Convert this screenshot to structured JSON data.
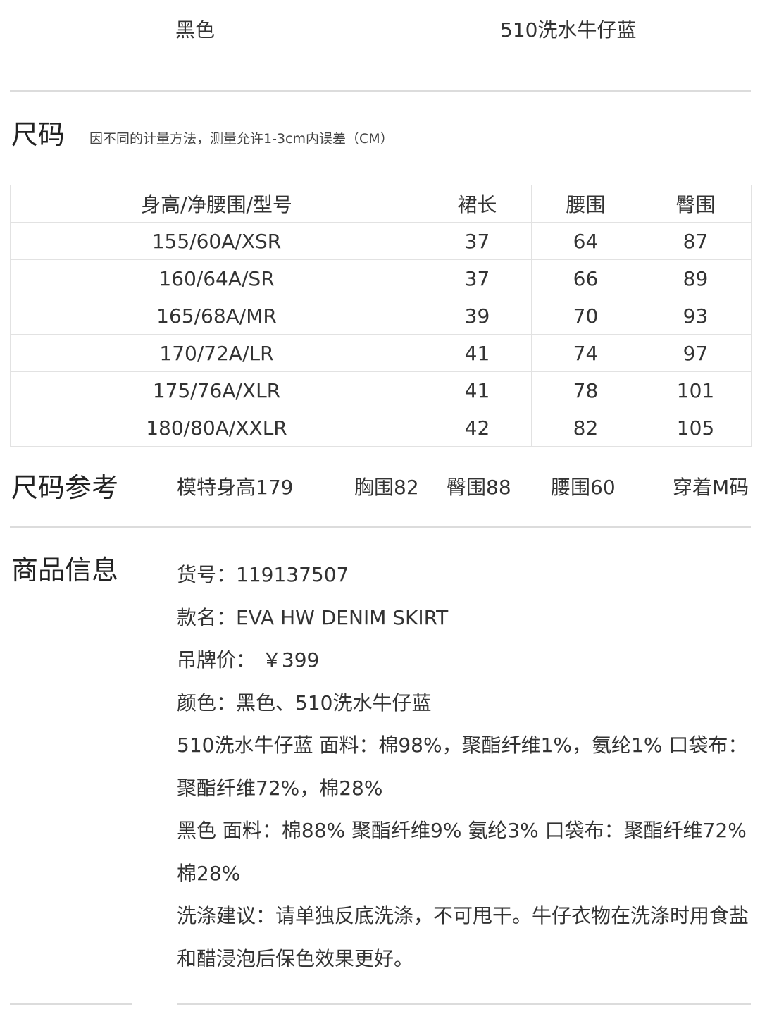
{
  "colors": [
    "黑色",
    "510洗水牛仔蓝"
  ],
  "size": {
    "title": "尺码",
    "note": "因不同的计量方法，测量允许1-3cm内误差（CM）",
    "headers": [
      "身高/净腰围/型号",
      "裙长",
      "腰围",
      "臀围"
    ],
    "rows": [
      [
        "155/60A/XSR",
        "37",
        "64",
        "87"
      ],
      [
        "160/64A/SR",
        "37",
        "66",
        "89"
      ],
      [
        "165/68A/MR",
        "39",
        "70",
        "93"
      ],
      [
        "170/72A/LR",
        "41",
        "74",
        "97"
      ],
      [
        "175/76A/XLR",
        "41",
        "78",
        "101"
      ],
      [
        "180/80A/XXLR",
        "42",
        "82",
        "105"
      ]
    ]
  },
  "size_reference": {
    "title": "尺码参考",
    "items": [
      "模特身高179",
      "胸围82",
      "臀围88",
      "腰围60",
      "穿着M码"
    ]
  },
  "product_info": {
    "title": "商品信息",
    "lines": [
      "货号：119137507",
      "款名：EVA HW DENIM SKIRT",
      "吊牌价： ￥399",
      "颜色：黑色、510洗水牛仔蓝",
      "510洗水牛仔蓝 面料：棉98%，聚酯纤维1%，氨纶1% 口袋布：聚酯纤维72%，棉28%",
      "黑色 面料：棉88% 聚酯纤维9% 氨纶3% 口袋布：聚酯纤维72% 棉28%",
      "洗涤建议：请单独反底洗涤，不可甩干。牛仔衣物在洗涤时用食盐和醋浸泡后保色效果更好。"
    ]
  }
}
